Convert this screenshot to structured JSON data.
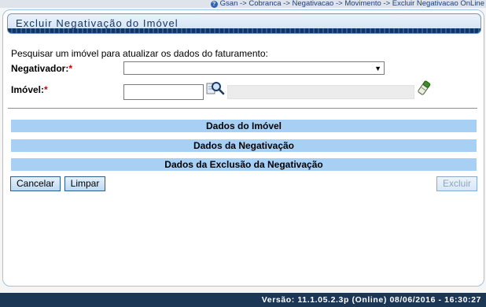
{
  "breadcrumb": {
    "icon": "help-icon",
    "text": "Gsan -> Cobranca -> Negativacao -> Movimento -> Excluir Negativacao OnLine"
  },
  "title": "Excluir Negativação do Imóvel",
  "instructions": "Pesquisar um imóvel para atualizar os dados do faturamento:",
  "form": {
    "negativador_label": "Negativador:",
    "negativador_value": "",
    "imovel_label": "Imóvel:",
    "imovel_value": "",
    "imovel_description": "",
    "required_mark": "*"
  },
  "sections": [
    {
      "label": "Dados do Imóvel"
    },
    {
      "label": "Dados da Negativação"
    },
    {
      "label": "Dados da Exclusão da Negativação"
    }
  ],
  "buttons": {
    "cancel": "Cancelar",
    "clear": "Limpar",
    "delete": "Excluir"
  },
  "footer": {
    "version": "Versão: 11.1.05.2.3p (Online) 08/06/2016 - 16:30:27"
  },
  "colors": {
    "section_bg": "#a8d0f5",
    "footer_bg": "#1c3655",
    "title_text": "#14335f"
  }
}
